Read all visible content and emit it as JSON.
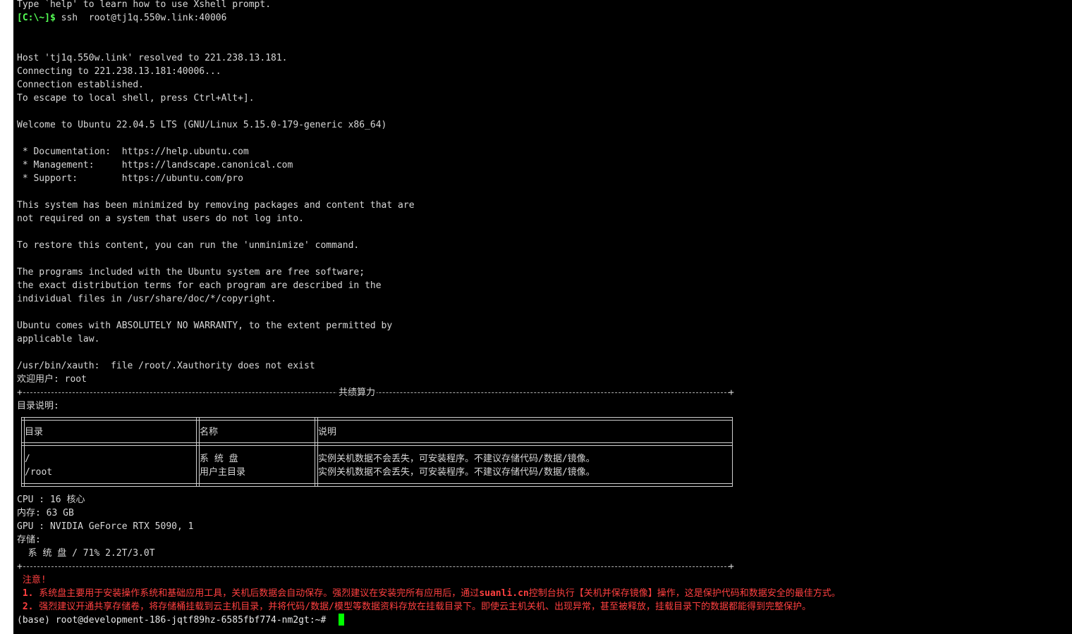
{
  "terminal": {
    "lines": {
      "l0": "Type `help' to learn how to use Xshell prompt.",
      "prompt_local": "[C:\\~]$",
      "cmd_ssh": " ssh  root@tj1q.550w.link:40006",
      "l3": "Host 'tj1q.550w.link' resolved to 221.238.13.181.",
      "l4": "Connecting to 221.238.13.181:40006...",
      "l5": "Connection established.",
      "l6": "To escape to local shell, press Ctrl+Alt+].",
      "l7": "Welcome to Ubuntu 22.04.5 LTS (GNU/Linux 5.15.0-179-generic x86_64)",
      "l8": " * Documentation:  https://help.ubuntu.com",
      "l9": " * Management:     https://landscape.canonical.com",
      "l10": " * Support:        https://ubuntu.com/pro",
      "l11": "This system has been minimized by removing packages and content that are",
      "l12": "not required on a system that users do not log into.",
      "l13": "To restore this content, you can run the 'unminimize' command.",
      "l14": "The programs included with the Ubuntu system are free software;",
      "l15": "the exact distribution terms for each program are described in the",
      "l16": "individual files in /usr/share/doc/*/copyright.",
      "l17": "Ubuntu comes with ABSOLUTELY NO WARRANTY, to the extent permitted by",
      "l18": "applicable law.",
      "l19": "/usr/bin/xauth:  file /root/.Xauthority does not exist",
      "l20": "欢迎用户: root",
      "banner_title": "共绩算力",
      "dir_desc": "目录说明:",
      "cpu": "CPU : 16 核心",
      "mem": "内存: 63 GB",
      "gpu": "GPU : NVIDIA GeForce RTX 5090, 1",
      "storage": "存储:",
      "storage_sys": "  系 统 盘 / 71% 2.2T/3.0T",
      "note_title": " 注意!",
      "note1_num": " 1.",
      "note1_a": " 系统盘主要用于安装操作系统和基础应用工具，关机后数据会自动保存。强烈建议在安装完所有应用后，通过",
      "note1_b": "suanli.cn",
      "note1_c": "控制台执行【关机并保存镜像】操作，这是保护代码和数据安全的最佳方式。",
      "note2_num": " 2.",
      "note2_a": " 强烈建议开通共享存储卷，将存储桶挂载到云主机目录，并将代码/数据/模型等数据资料存放在挂载目录下。即使云主机关机、出现异常，甚至被释放，挂载目录下的数据都能得到完整保护。",
      "final_prompt": "(base) root@development-186-jqtf89hz-6585fbf774-nm2gt:~#"
    },
    "table": {
      "headers": [
        "目录",
        "名称",
        "说明"
      ],
      "rows": [
        [
          "/",
          "系 统 盘",
          "实例关机数据不会丢失，可安装程序。不建议存储代码/数据/镜像。"
        ],
        [
          "/root",
          "用户主目录",
          "实例关机数据不会丢失，可安装程序。不建议存储代码/数据/镜像。"
        ]
      ]
    },
    "colors": {
      "background": "#000000",
      "text": "#d8d8d8",
      "prompt_green": "#55ff55",
      "warning_red": "#ff4040",
      "cursor": "#00ff00"
    }
  }
}
